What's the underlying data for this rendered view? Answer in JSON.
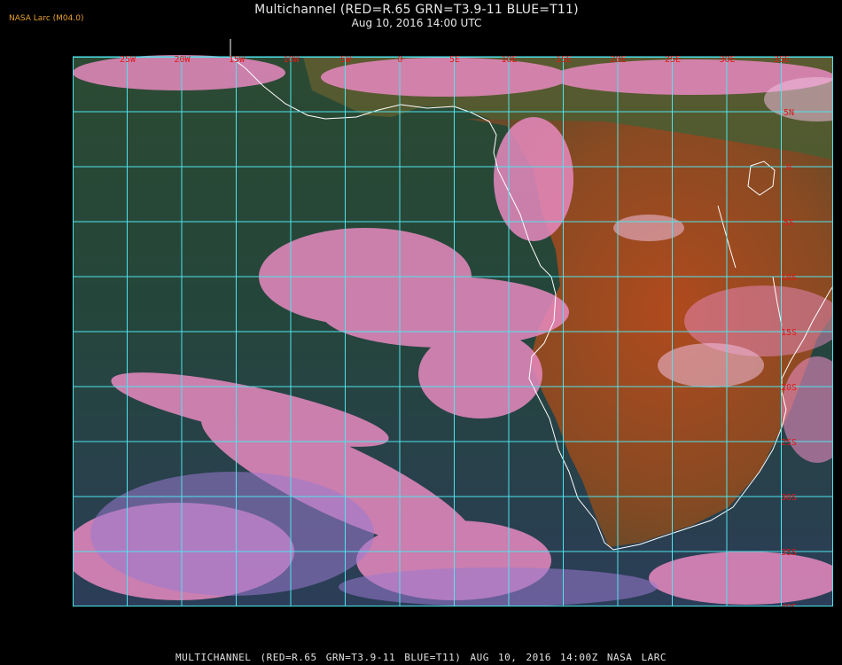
{
  "header": {
    "source_label": "NASA Larc (M04.0)",
    "title": "Multichannel (RED=R.65 GRN=T3.9-11 BLUE=T11)",
    "datetime": "Aug 10, 2016 14:00 UTC"
  },
  "map": {
    "lon_labels": [
      "25W",
      "20W",
      "15W",
      "10W",
      "5W",
      "0",
      "5E",
      "10E",
      "15E",
      "20E",
      "25E",
      "30E",
      "35E"
    ],
    "lat_labels": [
      "5N",
      "0",
      "5S",
      "10S",
      "15S",
      "20S",
      "25S",
      "30S",
      "35S",
      "40S"
    ],
    "grid_color": "#4ee4ee",
    "label_color": "#e01818",
    "coast_color": "#ffffff"
  },
  "footer": {
    "caption": "MULTICHANNEL (RED=R.65 GRN=T3.9-11 BLUE=T11) AUG 10, 2016 14:00Z NASA LARC"
  }
}
